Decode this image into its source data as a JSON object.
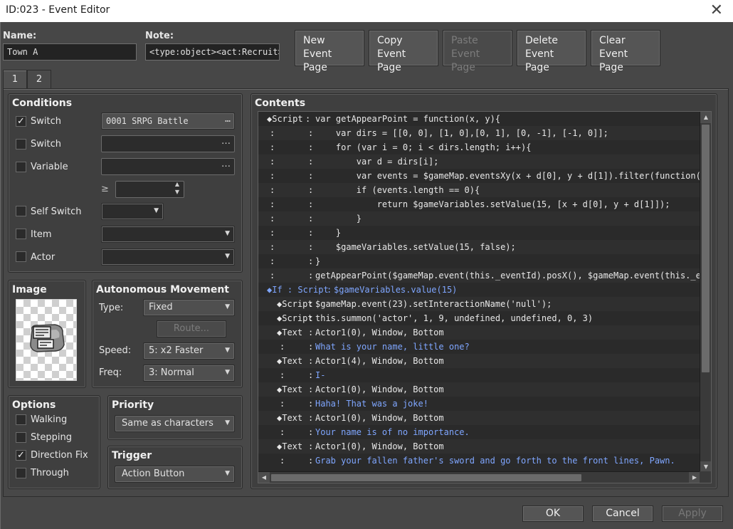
{
  "window": {
    "title": "ID:023 - Event Editor"
  },
  "header": {
    "name_label": "Name:",
    "name_value": "Town A",
    "note_label": "Note:",
    "note_value": "<type:object><act:Recruit>",
    "buttons": [
      {
        "line1": "New",
        "line2": "Event Page",
        "enabled": true
      },
      {
        "line1": "Copy",
        "line2": "Event Page",
        "enabled": true
      },
      {
        "line1": "Paste",
        "line2": "Event Page",
        "enabled": false
      },
      {
        "line1": "Delete",
        "line2": "Event Page",
        "enabled": true
      },
      {
        "line1": "Clear",
        "line2": "Event Page",
        "enabled": true
      }
    ]
  },
  "tabs": [
    {
      "label": "1",
      "active": true
    },
    {
      "label": "2",
      "active": false
    }
  ],
  "conditions": {
    "title": "Conditions",
    "switch1": {
      "label": "Switch",
      "checked": true,
      "value": "0001 SRPG Battle"
    },
    "switch2": {
      "label": "Switch",
      "checked": false,
      "value": ""
    },
    "variable": {
      "label": "Variable",
      "checked": false,
      "value": "",
      "ge": "≥"
    },
    "self_switch": {
      "label": "Self Switch",
      "checked": false
    },
    "item": {
      "label": "Item",
      "checked": false
    },
    "actor": {
      "label": "Actor",
      "checked": false
    }
  },
  "image": {
    "title": "Image"
  },
  "movement": {
    "title": "Autonomous Movement",
    "type_label": "Type:",
    "type_value": "Fixed",
    "route_label": "Route...",
    "speed_label": "Speed:",
    "speed_value": "5: x2 Faster",
    "freq_label": "Freq:",
    "freq_value": "3: Normal"
  },
  "options": {
    "title": "Options",
    "items": [
      {
        "label": "Walking",
        "checked": false
      },
      {
        "label": "Stepping",
        "checked": false
      },
      {
        "label": "Direction Fix",
        "checked": true
      },
      {
        "label": "Through",
        "checked": false
      }
    ]
  },
  "priority": {
    "title": "Priority",
    "value": "Same as characters"
  },
  "trigger": {
    "title": "Trigger",
    "value": "Action Button"
  },
  "contents": {
    "title": "Contents",
    "lines": [
      {
        "marker": "◆Script",
        "text": "var getAppearPoint = function(x, y){",
        "indent": 0,
        "color": "white",
        "alt": false
      },
      {
        "marker": ":",
        "text": "    var dirs = [[0, 0], [1, 0],[0, 1], [0, -1], [-1, 0]];",
        "indent": 0,
        "color": "white",
        "alt": true
      },
      {
        "marker": ":",
        "text": "    for (var i = 0; i < dirs.length; i++){",
        "indent": 0,
        "color": "white",
        "alt": false
      },
      {
        "marker": ":",
        "text": "        var d = dirs[i];",
        "indent": 0,
        "color": "white",
        "alt": true
      },
      {
        "marker": ":",
        "text": "        var events = $gameMap.eventsXy(x + d[0], y + d[1]).filter(function(event",
        "indent": 0,
        "color": "white",
        "alt": false
      },
      {
        "marker": ":",
        "text": "        if (events.length == 0){",
        "indent": 0,
        "color": "white",
        "alt": true
      },
      {
        "marker": ":",
        "text": "            return $gameVariables.setValue(15, [x + d[0], y + d[1]]);",
        "indent": 0,
        "color": "white",
        "alt": false
      },
      {
        "marker": ":",
        "text": "        }",
        "indent": 0,
        "color": "white",
        "alt": true
      },
      {
        "marker": ":",
        "text": "    }",
        "indent": 0,
        "color": "white",
        "alt": false
      },
      {
        "marker": ":",
        "text": "    $gameVariables.setValue(15, false);",
        "indent": 0,
        "color": "white",
        "alt": true
      },
      {
        "marker": ":",
        "text": "}",
        "indent": 0,
        "color": "white",
        "alt": false
      },
      {
        "marker": ":",
        "text": "getAppearPoint($gameMap.event(this._eventId).posX(), $gameMap.event(this._eventI",
        "indent": 0,
        "color": "white",
        "alt": true
      },
      {
        "marker": "◆If : Script",
        "text": "$gameVariables.value(15)",
        "indent": -1,
        "color": "blue",
        "alt": false
      },
      {
        "marker": "◆Script",
        "text": "$gameMap.event(23).setInteractionName('null');",
        "indent": 1,
        "color": "white",
        "alt": true
      },
      {
        "marker": "◆Script",
        "text": "this.summon('actor', 1, 9, undefined, undefined, 0, 3)",
        "indent": 1,
        "color": "white",
        "alt": false
      },
      {
        "marker": "◆Text",
        "text": "Actor1(0), Window, Bottom",
        "indent": 1,
        "color": "white",
        "alt": true
      },
      {
        "marker": ":",
        "text": "What is your name, little one?",
        "indent": 1,
        "color": "white",
        "alt": false
      },
      {
        "marker": "◆Text",
        "text": "Actor1(4), Window, Bottom",
        "indent": 1,
        "color": "white",
        "alt": true
      },
      {
        "marker": ":",
        "text": "I-",
        "indent": 1,
        "color": "white",
        "alt": false
      },
      {
        "marker": "◆Text",
        "text": "Actor1(0), Window, Bottom",
        "indent": 1,
        "color": "white",
        "alt": true
      },
      {
        "marker": ":",
        "text": "Haha! That was a joke!",
        "indent": 1,
        "color": "white",
        "alt": false
      },
      {
        "marker": "◆Text",
        "text": "Actor1(0), Window, Bottom",
        "indent": 1,
        "color": "white",
        "alt": true
      },
      {
        "marker": ":",
        "text": "Your name is of no importance.",
        "indent": 1,
        "color": "white",
        "alt": false
      },
      {
        "marker": "◆Text",
        "text": "Actor1(0), Window, Bottom",
        "indent": 1,
        "color": "white",
        "alt": true
      },
      {
        "marker": ":",
        "text": "Grab your fallen father's sword and go forth to the front lines, Pawn.",
        "indent": 1,
        "color": "white",
        "alt": false
      }
    ]
  },
  "footer": {
    "ok": "OK",
    "cancel": "Cancel",
    "apply": "Apply"
  },
  "colors": {
    "bg": "#474747",
    "code_bg": "#2a2a2a",
    "blue_text": "#7fa6ff"
  }
}
